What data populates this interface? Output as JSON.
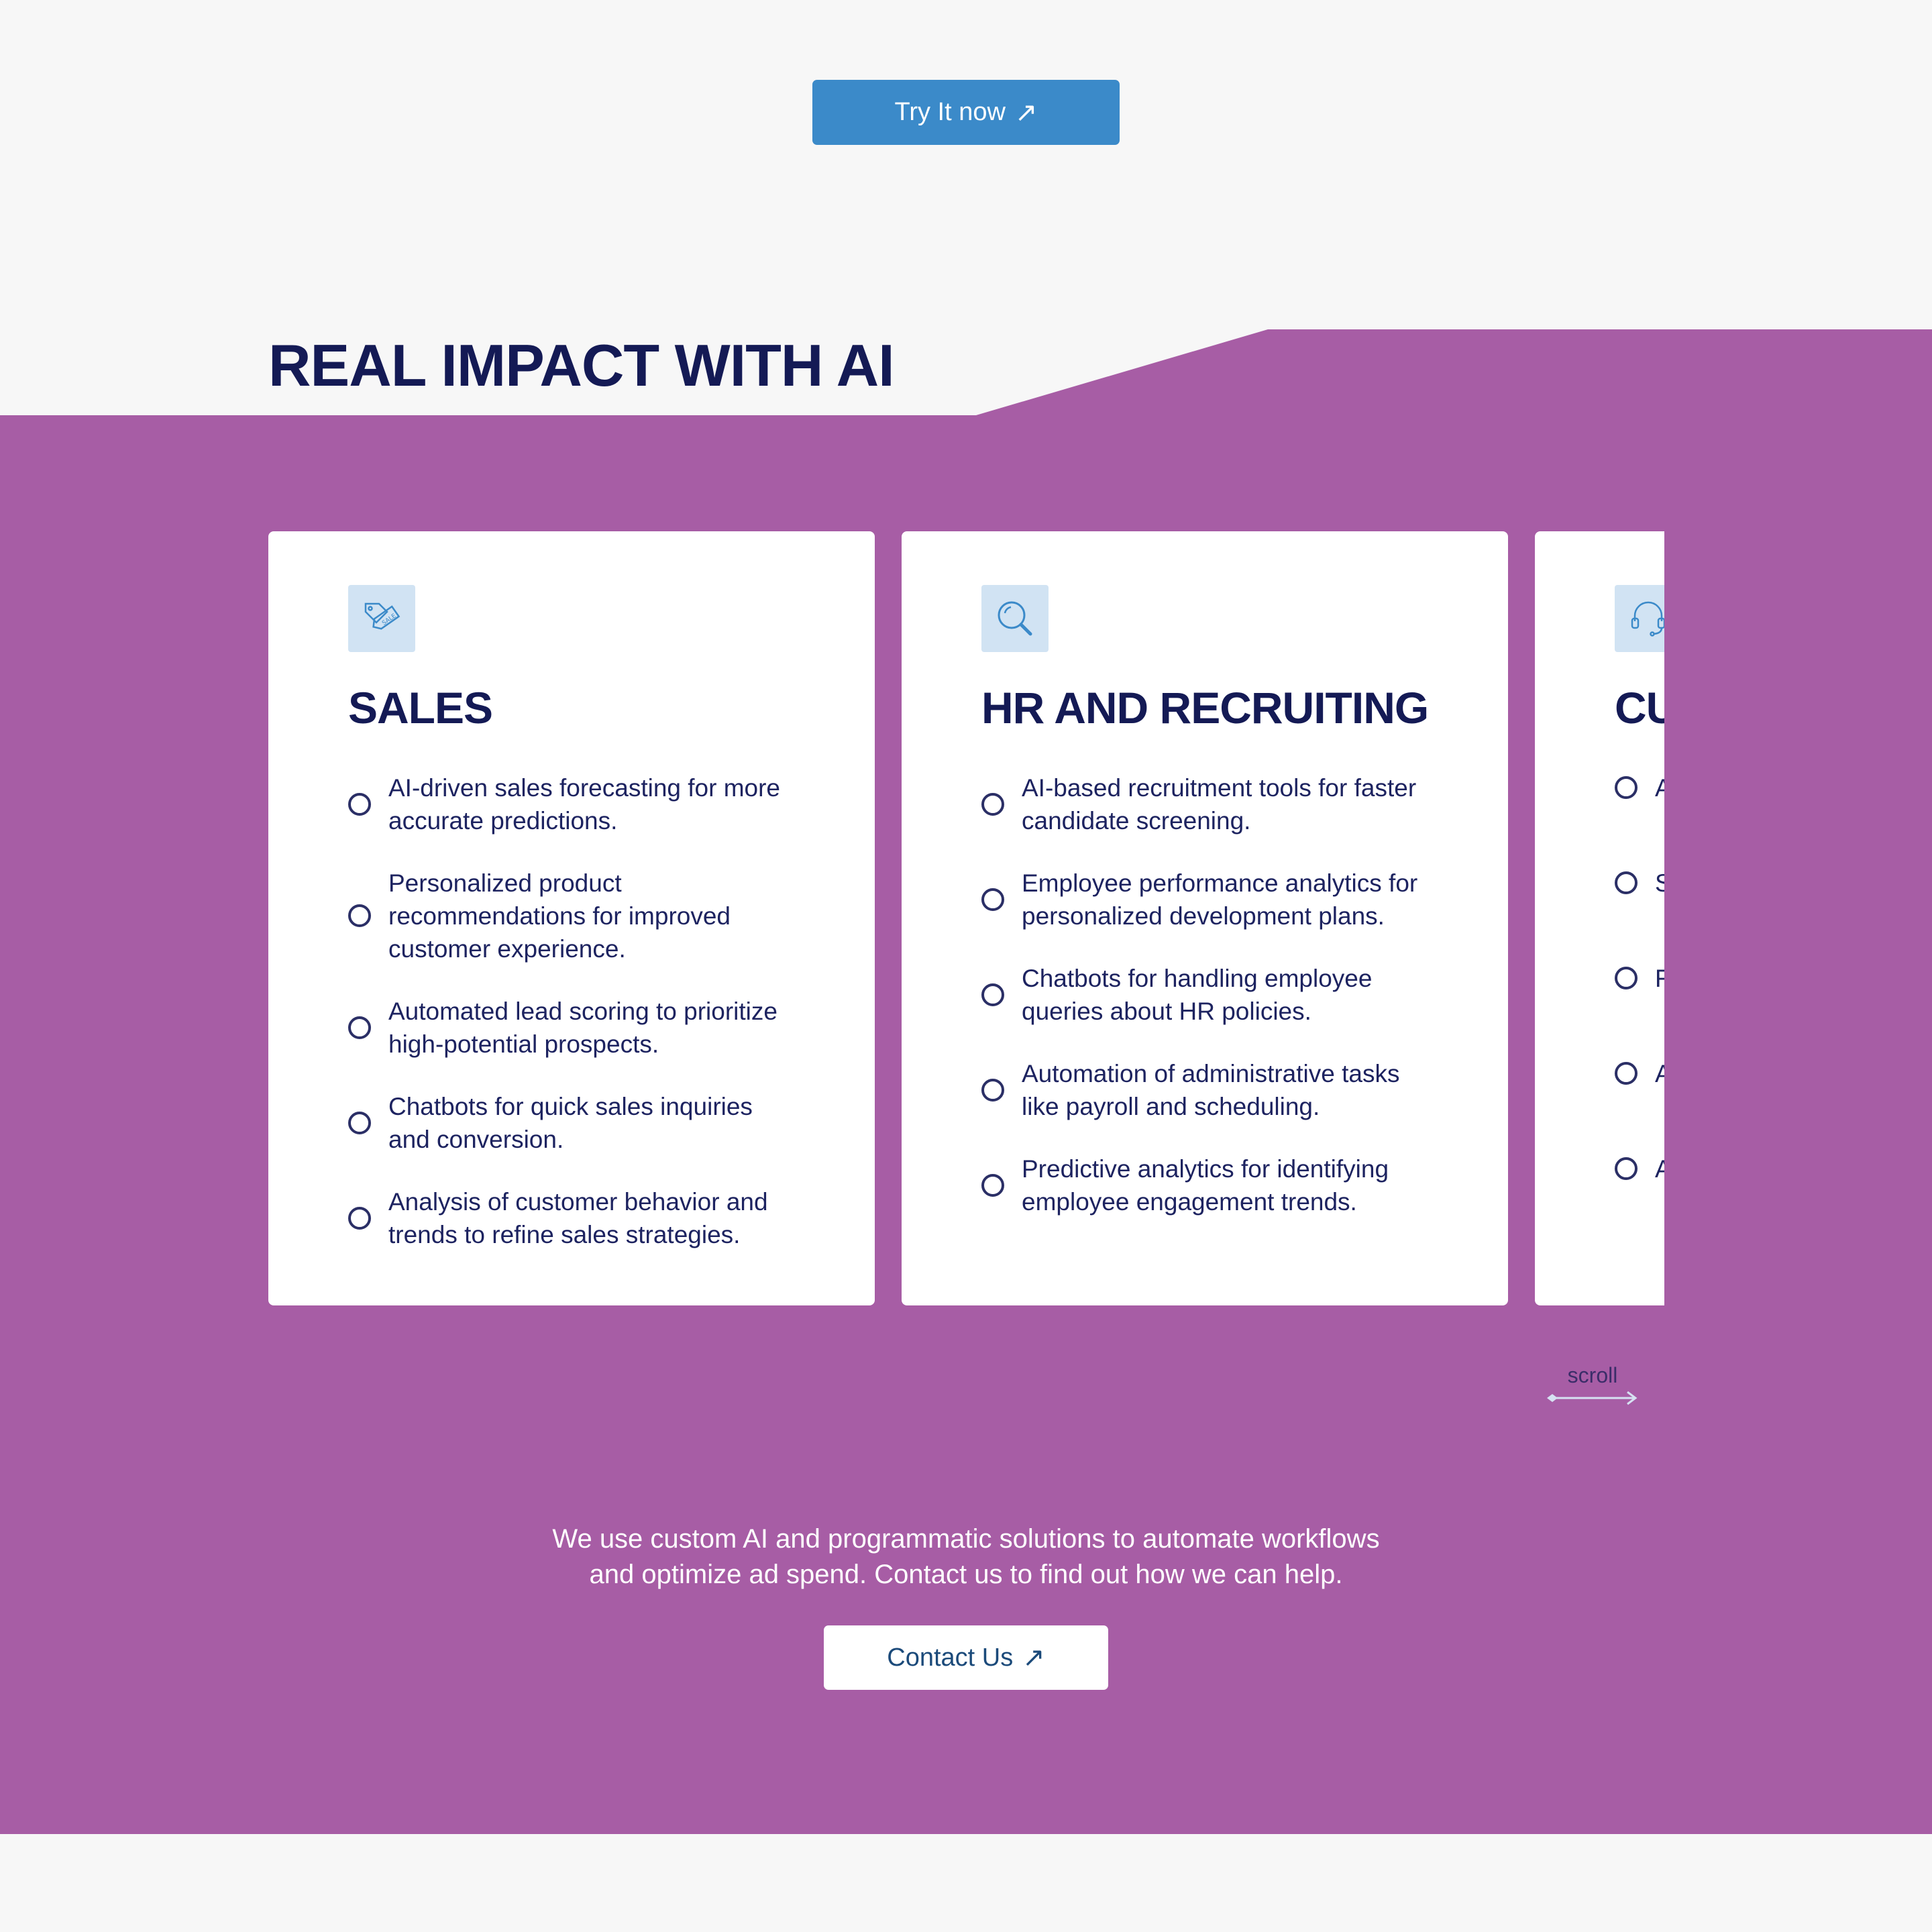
{
  "top_cta": {
    "label": "Try It now",
    "arrow": "↗"
  },
  "section": {
    "title": "REAL IMPACT WITH AI"
  },
  "cards": [
    {
      "icon": "sale-tag-icon",
      "title": "SALES",
      "items": [
        "AI-driven sales forecasting for more accurate predictions.",
        "Personalized product recommendations for improved customer experience.",
        "Automated lead scoring to prioritize high-potential prospects.",
        "Chatbots for quick sales inquiries and conversion.",
        "Analysis of customer behavior and trends to refine sales strategies."
      ]
    },
    {
      "icon": "search-icon",
      "title": "HR AND RECRUITING",
      "items": [
        "AI-based recruitment tools for faster candidate screening.",
        "Employee performance analytics for personalized development plans.",
        "Chatbots for handling employee queries about HR policies.",
        "Automation of administrative tasks like payroll and scheduling.",
        "Predictive analytics for identifying employee engagement trends."
      ]
    },
    {
      "icon": "headset-icon",
      "title": "CU",
      "items": [
        "A s",
        "S u",
        "F t",
        "A e",
        "A c"
      ]
    }
  ],
  "scroll_hint": {
    "label": "scroll"
  },
  "bottom_cta": {
    "text_line1": "We use custom AI and programmatic solutions to automate workflows",
    "text_line2": "and optimize ad spend. Contact us to find out how we can help.",
    "button_label": "Contact Us",
    "arrow": "↗"
  },
  "colors": {
    "page_background": "#f7f7f7",
    "section_purple": "#a75da5",
    "heading_navy": "#141a55",
    "primary_button": "#3b8ac9",
    "icon_tile": "#d1e3f3"
  }
}
